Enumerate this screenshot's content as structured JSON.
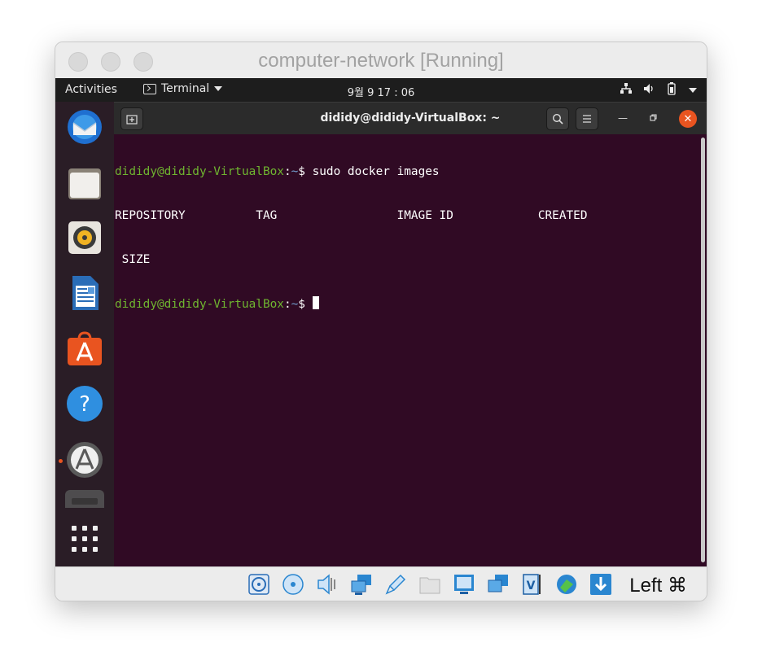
{
  "host_window": {
    "title": "computer-network [Running]"
  },
  "top_bar": {
    "activities_label": "Activities",
    "app_menu_label": "Terminal",
    "clock": "9월 9  17 : 06"
  },
  "dock": {
    "items": [
      {
        "name": "thunderbird-icon"
      },
      {
        "name": "files-icon"
      },
      {
        "name": "rhythmbox-icon"
      },
      {
        "name": "libreoffice-writer-icon"
      },
      {
        "name": "ubuntu-software-icon"
      },
      {
        "name": "help-icon"
      },
      {
        "name": "software-updater-icon"
      },
      {
        "name": "terminal-icon"
      },
      {
        "name": "show-applications-icon"
      }
    ]
  },
  "terminal": {
    "title": "dididy@dididy-VirtualBox: ~",
    "prompt_user": "dididy@dididy-VirtualBox",
    "prompt_sep": ":",
    "prompt_path": "~",
    "prompt_symbol": "$ ",
    "command": "sudo docker images",
    "header_line_1": "REPOSITORY          TAG                 IMAGE ID            CREATED",
    "header_line_2": " SIZE"
  },
  "status_bar": {
    "host_key": "Left ⌘"
  },
  "colors": {
    "terminal_bg": "#300a24",
    "prompt_user": "#6fb530",
    "prompt_path": "#729fcf",
    "accent": "#e95420"
  }
}
